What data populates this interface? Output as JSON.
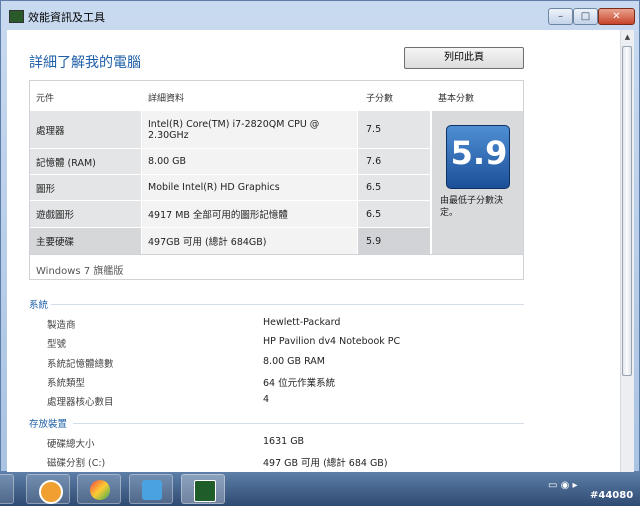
{
  "window": {
    "title": "效能資訊及工具",
    "min_label": "–",
    "max_label": "□",
    "close_label": "✕"
  },
  "page": {
    "heading": "詳細了解我的電腦",
    "print_button": "列印此頁"
  },
  "score_table": {
    "headers": {
      "component": "元件",
      "details": "詳細資料",
      "subscore": "子分數",
      "base_score": "基本分數"
    },
    "rows": [
      {
        "component": "處理器",
        "details": "Intel(R) Core(TM) i7-2820QM CPU @ 2.30GHz",
        "subscore": "7.5"
      },
      {
        "component": "記憶體 (RAM)",
        "details": "8.00 GB",
        "subscore": "7.6"
      },
      {
        "component": "圖形",
        "details": "Mobile Intel(R) HD Graphics",
        "subscore": "6.5"
      },
      {
        "component": "遊戲圖形",
        "details": "4917 MB 全部可用的圖形記憶體",
        "subscore": "6.5"
      },
      {
        "component": "主要硬碟",
        "details": "497GB 可用 (總計 684GB)",
        "subscore": "5.9"
      }
    ],
    "base_score": "5.9",
    "base_note": "由最低子分數決定。",
    "edition": "Windows 7 旗艦版"
  },
  "system": {
    "title": "系統",
    "items": [
      {
        "key": "製造商",
        "value": "Hewlett-Packard"
      },
      {
        "key": "型號",
        "value": "HP Pavilion dv4 Notebook PC"
      },
      {
        "key": "系統記憶體總數",
        "value": "8.00 GB RAM"
      },
      {
        "key": "系統類型",
        "value": "64 位元作業系統"
      },
      {
        "key": "處理器核心數目",
        "value": "4"
      }
    ]
  },
  "storage": {
    "title": "存放裝置",
    "items": [
      {
        "key": "硬碟總大小",
        "value": "1631 GB"
      },
      {
        "key": "磁碟分割 (C:)",
        "value": "497 GB 可用 (總計 684 GB)"
      }
    ]
  },
  "taskbar": {
    "stamp": "#44080"
  },
  "colors": {
    "accent": "#1e5fa8",
    "score_tile": "#2f6fbf"
  }
}
